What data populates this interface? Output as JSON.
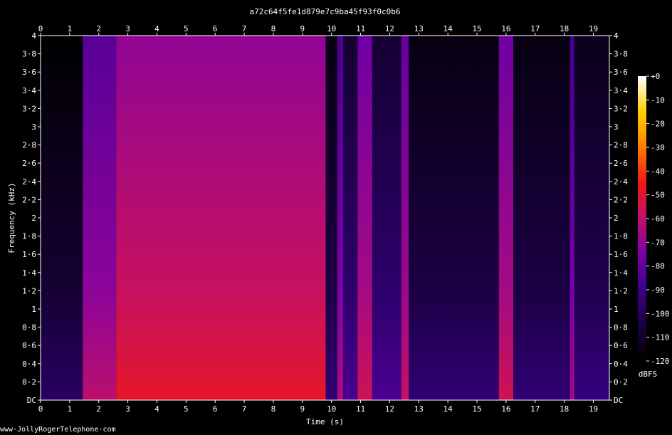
{
  "chart_data": {
    "type": "heatmap",
    "title": "a72c64f5fe1d879e7c9ba45f93f0c0b6",
    "xlabel": "Time (s)",
    "ylabel": "Frequency (kHz)",
    "colorbar_label": "dBFS",
    "xlim": [
      0,
      19.55
    ],
    "ylim": [
      0,
      4
    ],
    "x_ticks": [
      0,
      1,
      2,
      3,
      4,
      5,
      6,
      7,
      8,
      9,
      10,
      11,
      12,
      13,
      14,
      15,
      16,
      17,
      18,
      19
    ],
    "y_tick_values": [
      0,
      0.2,
      0.4,
      0.6,
      0.8,
      1,
      1.2,
      1.4,
      1.6,
      1.8,
      2,
      2.2,
      2.4,
      2.6,
      2.8,
      3,
      3.2,
      3.4,
      3.6,
      3.8,
      4
    ],
    "y_tick_labels": [
      "DC",
      "0·2",
      "0·4",
      "0·6",
      "0·8",
      "1",
      "1·2",
      "1·4",
      "1·6",
      "1·8",
      "2",
      "2·2",
      "2·4",
      "2·6",
      "2·8",
      "3",
      "3·2",
      "3·4",
      "3·6",
      "3·8",
      "4"
    ],
    "colorbar_range_dbfs": [
      -120,
      0
    ],
    "colorbar_tick_values": [
      0,
      -10,
      -20,
      -30,
      -40,
      -50,
      -60,
      -70,
      -80,
      -90,
      -100,
      -110,
      -120
    ],
    "colorbar_tick_labels": [
      "+0",
      "-10",
      "-20",
      "-30",
      "-40",
      "-50",
      "-60",
      "-70",
      "-80",
      "-90",
      "-100",
      "-110",
      "-120"
    ],
    "colormap": [
      "#000000",
      "#1a0040",
      "#3a0088",
      "#7a00aa",
      "#c0106a",
      "#f01818",
      "#ff7a00",
      "#ffd000",
      "#ffffff"
    ],
    "segments": [
      {
        "t0": 0.0,
        "t1": 1.45,
        "level_dbfs": -112
      },
      {
        "t0": 1.45,
        "t1": 2.6,
        "level_dbfs": -75
      },
      {
        "t0": 2.6,
        "t1": 9.8,
        "level_dbfs": -62
      },
      {
        "t0": 9.8,
        "t1": 10.2,
        "level_dbfs": -108
      },
      {
        "t0": 10.2,
        "t1": 10.4,
        "level_dbfs": -78
      },
      {
        "t0": 10.4,
        "t1": 10.9,
        "level_dbfs": -100
      },
      {
        "t0": 10.9,
        "t1": 11.4,
        "level_dbfs": -70
      },
      {
        "t0": 11.4,
        "t1": 12.4,
        "level_dbfs": -100
      },
      {
        "t0": 12.4,
        "t1": 12.65,
        "level_dbfs": -72
      },
      {
        "t0": 12.65,
        "t1": 15.75,
        "level_dbfs": -108
      },
      {
        "t0": 15.75,
        "t1": 16.25,
        "level_dbfs": -70
      },
      {
        "t0": 16.25,
        "t1": 18.2,
        "level_dbfs": -108
      },
      {
        "t0": 18.2,
        "t1": 18.35,
        "level_dbfs": -80
      },
      {
        "t0": 18.35,
        "t1": 19.55,
        "level_dbfs": -106
      }
    ]
  },
  "footer_url": "www·JollyRogerTelephone·com"
}
